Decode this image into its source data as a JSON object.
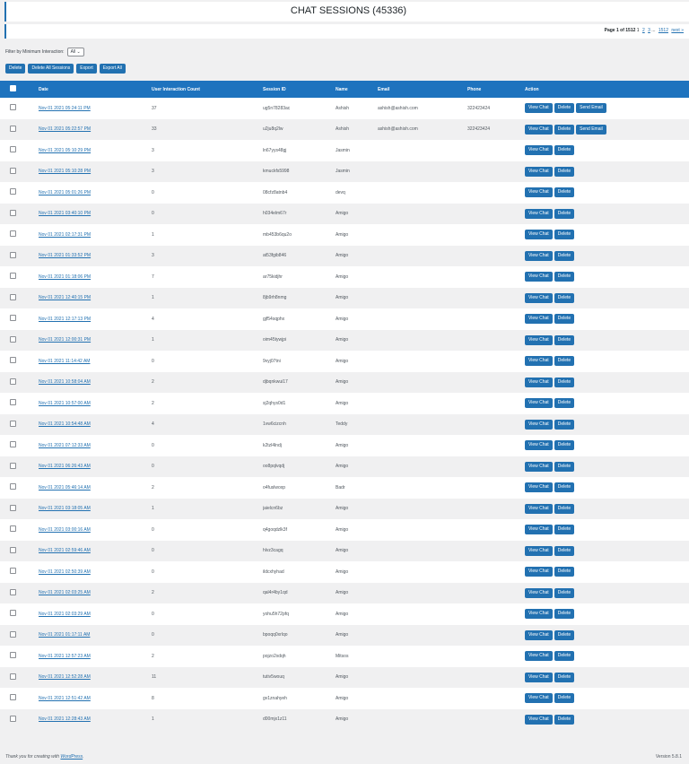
{
  "header": {
    "title": "CHAT SESSIONS (45336)"
  },
  "pagination": {
    "summary": "Page 1 of 1512",
    "current": "1",
    "pages": [
      "2",
      "3"
    ],
    "ellipsis": "...",
    "last": "1512",
    "next": "next »"
  },
  "filter": {
    "label": "Filter by Minimum Interaction:",
    "value": "All"
  },
  "toolbar": {
    "delete": "Delete",
    "delete_all": "Delete All Sessions",
    "export": "Export",
    "export_all": "Export All"
  },
  "columns": {
    "date": "Date",
    "count": "User Interaction Count",
    "session": "Session ID",
    "name": "Name",
    "email": "Email",
    "phone": "Phone",
    "action": "Action"
  },
  "actions": {
    "view": "View Chat",
    "delete": "Delete",
    "send": "Send Email"
  },
  "rows": [
    {
      "date": "Nov 01 2021 05:24:11 PM",
      "count": "37",
      "session": "ug5n78283ac",
      "name": "Ashish",
      "email": "ashish@ashish.com",
      "phone": "322423424",
      "send": true
    },
    {
      "date": "Nov 01 2021 05:22:57 PM",
      "count": "33",
      "session": "u2ju8q2lw",
      "name": "Ashish",
      "email": "ashish@ashish.com",
      "phone": "322423424",
      "send": true
    },
    {
      "date": "Nov 01 2021 05:10:29 PM",
      "count": "3",
      "session": "ln67yys48gj",
      "name": "Jasmin",
      "email": "",
      "phone": "",
      "send": false
    },
    {
      "date": "Nov 01 2021 05:10:28 PM",
      "count": "3",
      "session": "kmuckfs5998",
      "name": "Jasmin",
      "email": "",
      "phone": "",
      "send": false
    },
    {
      "date": "Nov 01 2021 05:01:26 PM",
      "count": "0",
      "session": "08cfz8atnb4",
      "name": "devq",
      "email": "",
      "phone": "",
      "send": false
    },
    {
      "date": "Nov 01 2021 03:40:10 PM",
      "count": "0",
      "session": "h034elm67r",
      "name": "Amigo",
      "email": "",
      "phone": "",
      "send": false
    },
    {
      "date": "Nov 01 2021 02:17:31 PM",
      "count": "1",
      "session": "mb453b6qu2o",
      "name": "Amigo",
      "email": "",
      "phone": "",
      "send": false
    },
    {
      "date": "Nov 01 2021 01:33:52 PM",
      "count": "3",
      "session": "at53fgib846",
      "name": "Amigo",
      "email": "",
      "phone": "",
      "send": false
    },
    {
      "date": "Nov 01 2021 01:18:06 PM",
      "count": "7",
      "session": "ar75kidjhr",
      "name": "Amigo",
      "email": "",
      "phone": "",
      "send": false
    },
    {
      "date": "Nov 01 2021 12:40:15 PM",
      "count": "1",
      "session": "8jb9rh8nmg",
      "name": "Amigo",
      "email": "",
      "phone": "",
      "send": false
    },
    {
      "date": "Nov 01 2021 12:17:13 PM",
      "count": "4",
      "session": "gjf54sqphx",
      "name": "Amigo",
      "email": "",
      "phone": "",
      "send": false
    },
    {
      "date": "Nov 01 2021 12:00:31 PM",
      "count": "1",
      "session": "oim45tywjpi",
      "name": "Amigo",
      "email": "",
      "phone": "",
      "send": false
    },
    {
      "date": "Nov 01 2021 11:14:42 AM",
      "count": "0",
      "session": "9vyj07tni",
      "name": "Amigo",
      "email": "",
      "phone": "",
      "send": false
    },
    {
      "date": "Nov 01 2021 10:58:04 AM",
      "count": "2",
      "session": "djbqnkwui17",
      "name": "Amigo",
      "email": "",
      "phone": "",
      "send": false
    },
    {
      "date": "Nov 01 2021 10:57:00 AM",
      "count": "2",
      "session": "sj2qhys0d1",
      "name": "Amigo",
      "email": "",
      "phone": "",
      "send": false
    },
    {
      "date": "Nov 01 2021 10:54:48 AM",
      "count": "4",
      "session": "1vw6cizcnh",
      "name": "Teddy",
      "email": "",
      "phone": "",
      "send": false
    },
    {
      "date": "Nov 01 2021 07:12:33 AM",
      "count": "0",
      "session": "k2tzl4lndj",
      "name": "Amigo",
      "email": "",
      "phone": "",
      "send": false
    },
    {
      "date": "Nov 01 2021 06:26:43 AM",
      "count": "0",
      "session": "oo8pqlvqdj",
      "name": "Amigo",
      "email": "",
      "phone": "",
      "send": false
    },
    {
      "date": "Nov 01 2021 05:46:14 AM",
      "count": "2",
      "session": "o4fuslwoxp",
      "name": "Badr",
      "email": "",
      "phone": "",
      "send": false
    },
    {
      "date": "Nov 01 2021 03:18:05 AM",
      "count": "1",
      "session": "jaielcn6bz",
      "name": "Amigo",
      "email": "",
      "phone": "",
      "send": false
    },
    {
      "date": "Nov 01 2021 03:00:16 AM",
      "count": "0",
      "session": "q4goqdzlk3f",
      "name": "Amigo",
      "email": "",
      "phone": "",
      "send": false
    },
    {
      "date": "Nov 01 2021 02:59:46 AM",
      "count": "0",
      "session": "hlvz3cagq",
      "name": "Amigo",
      "email": "",
      "phone": "",
      "send": false
    },
    {
      "date": "Nov 01 2021 02:50:39 AM",
      "count": "0",
      "session": "ildcxhyhad",
      "name": "Amigo",
      "email": "",
      "phone": "",
      "send": false
    },
    {
      "date": "Nov 01 2021 02:03:25 AM",
      "count": "2",
      "session": "qal4r4by1qd",
      "name": "Amigo",
      "email": "",
      "phone": "",
      "send": false
    },
    {
      "date": "Nov 01 2021 02:03:29 AM",
      "count": "0",
      "session": "yohu5h72pfq",
      "name": "Amigo",
      "email": "",
      "phone": "",
      "send": false
    },
    {
      "date": "Nov 01 2021 01:17:11 AM",
      "count": "0",
      "session": "bpoqq0xrlqo",
      "name": "Amigo",
      "email": "",
      "phone": "",
      "send": false
    },
    {
      "date": "Nov 01 2021 12:57:23 AM",
      "count": "2",
      "session": "pojzo2xdqh",
      "name": "Mitsos",
      "email": "",
      "phone": "",
      "send": false
    },
    {
      "date": "Nov 01 2021 12:52:28 AM",
      "count": "11",
      "session": "tutiv5wouq",
      "name": "Amigo",
      "email": "",
      "phone": "",
      "send": false
    },
    {
      "date": "Nov 01 2021 12:51:42 AM",
      "count": "8",
      "session": "gv1znahyeh",
      "name": "Amigo",
      "email": "",
      "phone": "",
      "send": false
    },
    {
      "date": "Nov 01 2021 12:28:43 AM",
      "count": "1",
      "session": "d00mjx1z11",
      "name": "Amigo",
      "email": "",
      "phone": "",
      "send": false
    }
  ],
  "footer": {
    "text": "Thank you for creating with",
    "link": "WordPress",
    "end": ".",
    "version": "Version 5.8.1"
  }
}
